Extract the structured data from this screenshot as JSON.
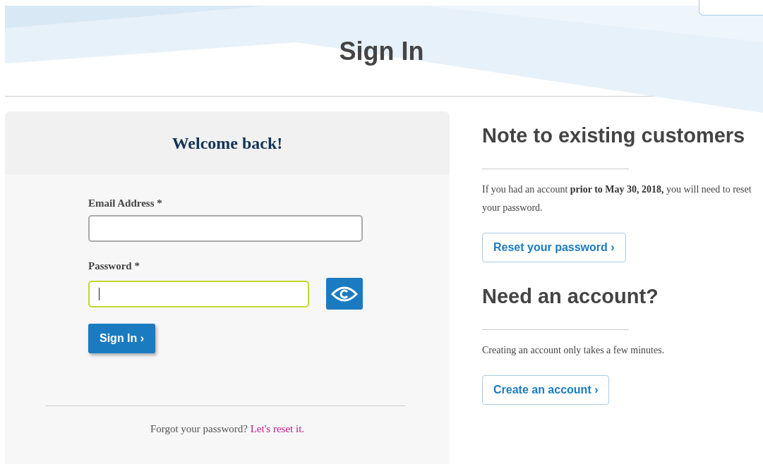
{
  "page_title": "Sign In",
  "login_card": {
    "heading": "Welcome back!",
    "fields": [
      {
        "label": "Email Address *",
        "kind": "plain",
        "focused": false
      },
      {
        "label": "Password *",
        "kind": "secret",
        "focused": true
      }
    ],
    "submit": "Sign In ›",
    "footer": {
      "text": "Forgot your password?",
      "link": "Let's reset it."
    }
  },
  "sections": [
    {
      "heading": "Note to existing customers",
      "text": "If you had an account **prior to May 30, 2018,** you will need to reset your password.",
      "button": "Reset your password ›"
    },
    {
      "heading": "Need an account?",
      "text": "Creating an account only takes a few minutes.",
      "button": "Create an account ›"
    }
  ]
}
